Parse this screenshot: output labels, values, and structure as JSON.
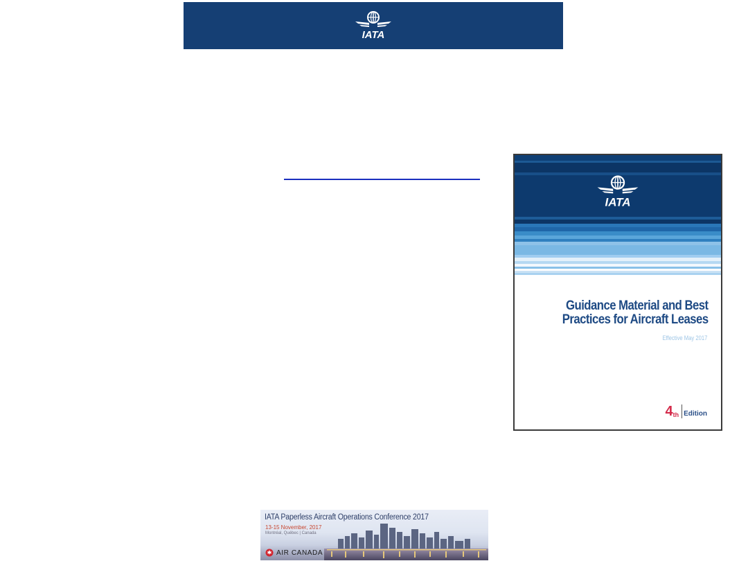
{
  "header": {
    "logo_text": "IATA",
    "background": "#153f74"
  },
  "link": {
    "color": "#1a2fbf"
  },
  "cover": {
    "logo_text": "IATA",
    "title_line1": "Guidance Material and Best",
    "title_line2": "Practices for Aircraft Leases",
    "effective": "Effective May 2017",
    "edition_number": "4",
    "edition_suffix": "th",
    "edition_word": "Edition"
  },
  "banner": {
    "title": "IATA Paperless Aircraft Operations Conference 2017",
    "dates": "13-15 November, 2017",
    "location": "Montréal, Québec | Canada",
    "sponsor": "AIR CANADA"
  }
}
